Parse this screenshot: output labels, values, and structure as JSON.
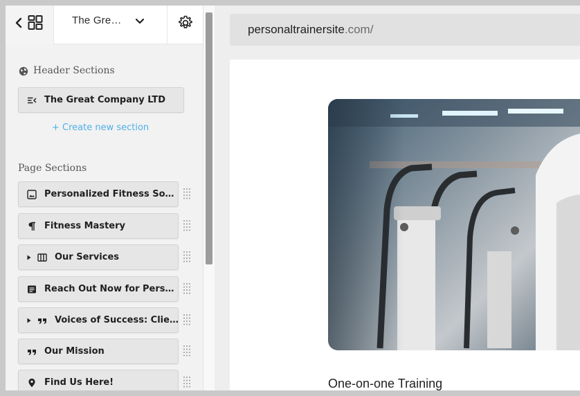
{
  "topbar": {
    "site_title": "The Gre…"
  },
  "header_sections": {
    "heading": "Header Sections",
    "items": [
      {
        "label": "The Great Company LTD",
        "icon": "menu-collapse-icon"
      }
    ],
    "create_link": "+ Create new section"
  },
  "page_sections": {
    "heading": "Page Sections",
    "items": [
      {
        "label": "Personalized Fitness So…",
        "icon": "image-icon",
        "expandable": false
      },
      {
        "label": "Fitness Mastery",
        "icon": "paragraph-icon",
        "expandable": false
      },
      {
        "label": "Our Services",
        "icon": "columns-icon",
        "expandable": true
      },
      {
        "label": "Reach Out Now for Pers…",
        "icon": "form-icon",
        "expandable": false
      },
      {
        "label": "Voices of Success: Clie…",
        "icon": "quote-icon",
        "expandable": true
      },
      {
        "label": "Our Mission",
        "icon": "quote-icon",
        "expandable": false
      },
      {
        "label": "Find Us Here!",
        "icon": "map-pin-icon",
        "expandable": false
      }
    ]
  },
  "preview": {
    "url_domain": "personaltrainersite",
    "url_rest": ".com/",
    "heading": "One-on-one Training"
  },
  "colors": {
    "link": "#4fb0e6",
    "scroll_thumb": "#9c9c9c",
    "item_bg": "#e6e6e6"
  }
}
